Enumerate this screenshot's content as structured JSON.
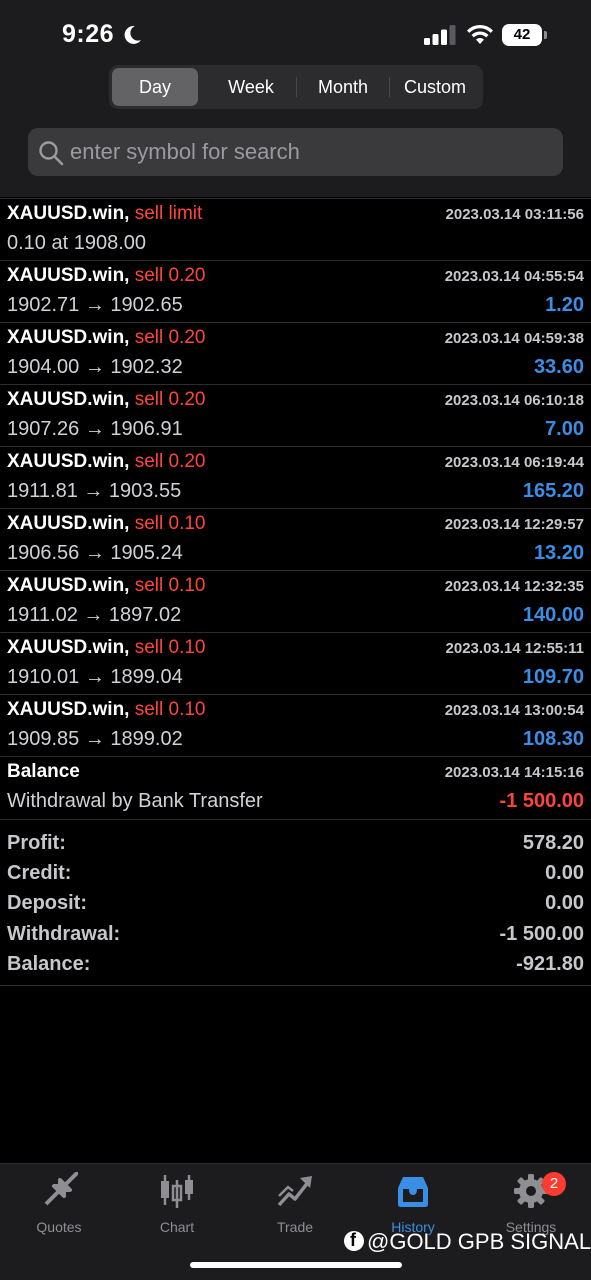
{
  "status_bar": {
    "time": "9:26",
    "battery": "42"
  },
  "period_tabs": [
    "Day",
    "Week",
    "Month",
    "Custom"
  ],
  "active_period": "Day",
  "search": {
    "placeholder": "enter symbol for search",
    "value": ""
  },
  "deals": [
    {
      "symbol": "XAUUSD.win,",
      "type": "sell limit",
      "time": "2023.03.14 03:11:56",
      "prices": "0.10 at 1908.00",
      "profit": ""
    },
    {
      "symbol": "XAUUSD.win,",
      "type": "sell 0.20",
      "time": "2023.03.14 04:55:54",
      "prices": "1902.71 → 1902.65",
      "profit": "1.20"
    },
    {
      "symbol": "XAUUSD.win,",
      "type": "sell 0.20",
      "time": "2023.03.14 04:59:38",
      "prices": "1904.00 → 1902.32",
      "profit": "33.60"
    },
    {
      "symbol": "XAUUSD.win,",
      "type": "sell 0.20",
      "time": "2023.03.14 06:10:18",
      "prices": "1907.26 → 1906.91",
      "profit": "7.00"
    },
    {
      "symbol": "XAUUSD.win,",
      "type": "sell 0.20",
      "time": "2023.03.14 06:19:44",
      "prices": "1911.81 → 1903.55",
      "profit": "165.20"
    },
    {
      "symbol": "XAUUSD.win,",
      "type": "sell 0.10",
      "time": "2023.03.14 12:29:57",
      "prices": "1906.56 → 1905.24",
      "profit": "13.20"
    },
    {
      "symbol": "XAUUSD.win,",
      "type": "sell 0.10",
      "time": "2023.03.14 12:32:35",
      "prices": "1911.02 → 1897.02",
      "profit": "140.00"
    },
    {
      "symbol": "XAUUSD.win,",
      "type": "sell 0.10",
      "time": "2023.03.14 12:55:11",
      "prices": "1910.01 → 1899.04",
      "profit": "109.70"
    },
    {
      "symbol": "XAUUSD.win,",
      "type": "sell 0.10",
      "time": "2023.03.14 13:00:54",
      "prices": "1909.85 → 1899.02",
      "profit": "108.30"
    }
  ],
  "balance_op": {
    "title": "Balance",
    "time": "2023.03.14 14:15:16",
    "comment": "Withdrawal by Bank Transfer",
    "amount": "-1 500.00"
  },
  "summary": [
    {
      "label": "Profit:",
      "value": "578.20"
    },
    {
      "label": "Credit:",
      "value": "0.00"
    },
    {
      "label": "Deposit:",
      "value": "0.00"
    },
    {
      "label": "Withdrawal:",
      "value": "-1 500.00"
    },
    {
      "label": "Balance:",
      "value": "-921.80"
    }
  ],
  "tabbar": {
    "items": [
      {
        "label": "Quotes",
        "icon": "quotes-arrows-icon"
      },
      {
        "label": "Chart",
        "icon": "candlestick-chart-icon"
      },
      {
        "label": "Trade",
        "icon": "trade-trend-icon"
      },
      {
        "label": "History",
        "icon": "history-inbox-icon"
      },
      {
        "label": "Settings",
        "icon": "gear-icon"
      }
    ],
    "active": "History",
    "settings_badge": "2"
  },
  "watermark": "@GOLD GPB SIGNALS",
  "colors": {
    "sell": "#ff453a",
    "profit": "#3a8ee6",
    "active_tab": "#3a8ee6",
    "background": "#000000"
  }
}
